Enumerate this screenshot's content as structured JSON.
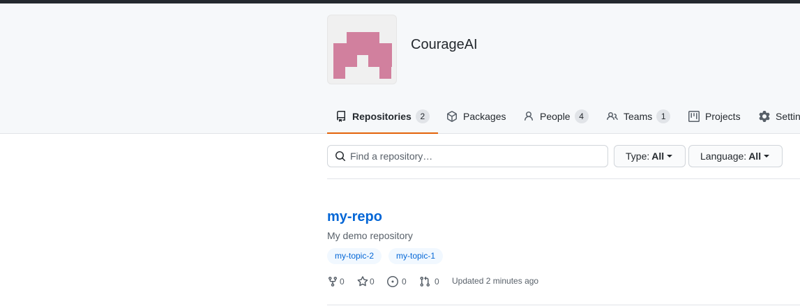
{
  "org": {
    "name": "CourageAI",
    "avatar_color": "#d1809e"
  },
  "tabs": [
    {
      "label": "Repositories",
      "count": "2",
      "icon": "repo-icon",
      "selected": true
    },
    {
      "label": "Packages",
      "icon": "package-icon"
    },
    {
      "label": "People",
      "count": "4",
      "icon": "person-icon"
    },
    {
      "label": "Teams",
      "count": "1",
      "icon": "people-icon"
    },
    {
      "label": "Projects",
      "icon": "project-icon"
    },
    {
      "label": "Settin",
      "icon": "gear-icon"
    }
  ],
  "filters": {
    "search_placeholder": "Find a repository…",
    "type_label": "Type:",
    "type_value": "All",
    "language_label": "Language:",
    "language_value": "All"
  },
  "repos": [
    {
      "name": "my-repo",
      "description": "My demo repository",
      "topics": [
        "my-topic-2",
        "my-topic-1"
      ],
      "forks": "0",
      "stars": "0",
      "issues": "0",
      "pulls": "0",
      "updated": "Updated 2 minutes ago"
    }
  ],
  "colors": {
    "accent": "#0366d6",
    "selected_tab_border": "#e36209"
  }
}
